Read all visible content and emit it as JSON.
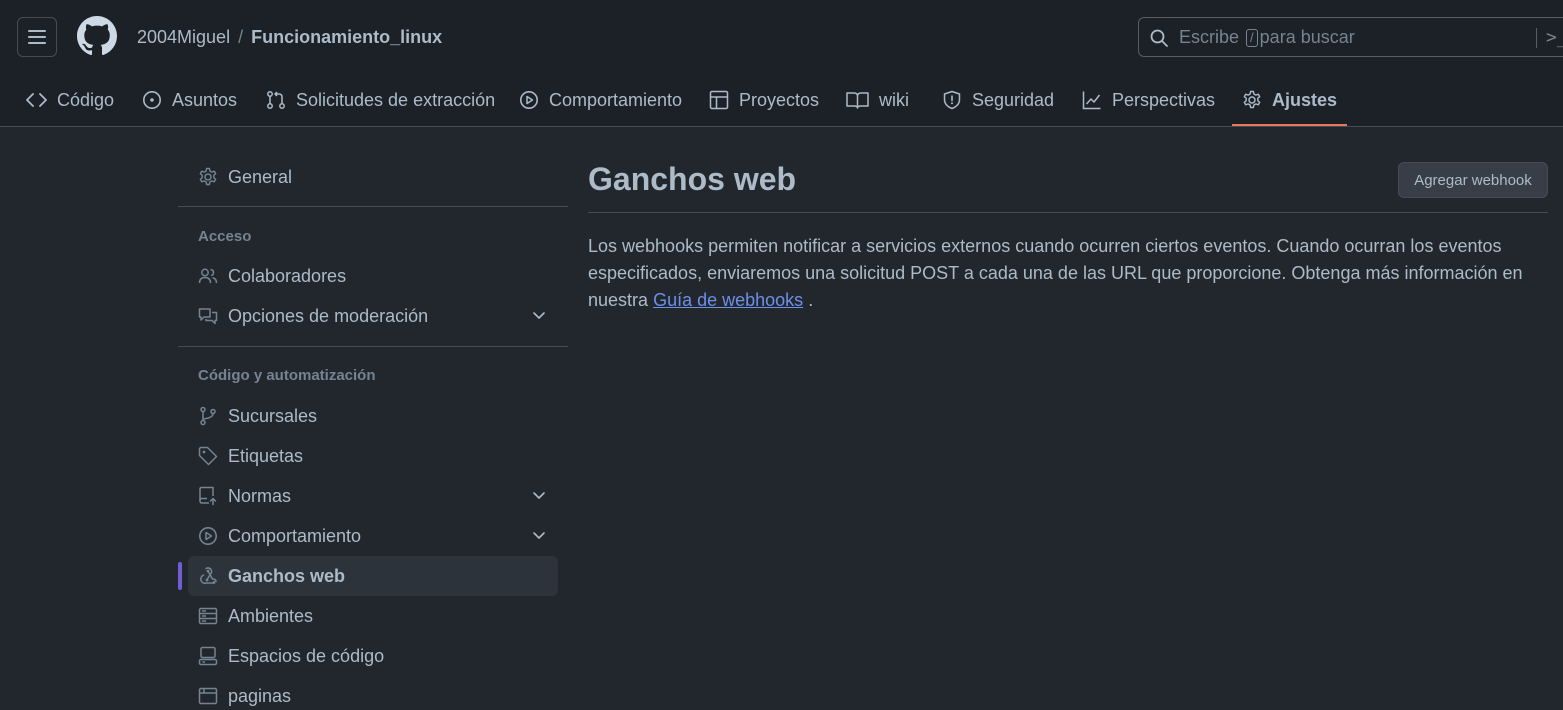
{
  "header": {
    "owner": "2004Miguel",
    "separator": "/",
    "repo": "Funcionamiento_linux",
    "search": {
      "prefix": "Escribe",
      "key": "/",
      "suffix": "para buscar",
      "command": ">_"
    }
  },
  "tabs": [
    {
      "label": "Código",
      "icon": "code-icon"
    },
    {
      "label": "Asuntos",
      "icon": "issue-opened-icon"
    },
    {
      "label": "Solicitudes de extracción",
      "icon": "git-pull-request-icon"
    },
    {
      "label": "Comportamiento",
      "icon": "play-icon"
    },
    {
      "label": "Proyectos",
      "icon": "table-icon"
    },
    {
      "label": "wiki",
      "icon": "book-icon"
    },
    {
      "label": "Seguridad",
      "icon": "shield-icon"
    },
    {
      "label": "Perspectivas",
      "icon": "graph-icon"
    },
    {
      "label": "Ajustes",
      "icon": "gear-icon",
      "active": true
    }
  ],
  "sidebar": {
    "general": "General",
    "access_heading": "Acceso",
    "access": [
      {
        "label": "Colaboradores",
        "icon": "people-icon"
      },
      {
        "label": "Opciones de moderación",
        "icon": "comment-discussion-icon",
        "expandable": true
      }
    ],
    "code_heading": "Código y automatización",
    "code": [
      {
        "label": "Sucursales",
        "icon": "git-branch-icon"
      },
      {
        "label": "Etiquetas",
        "icon": "tag-icon"
      },
      {
        "label": "Normas",
        "icon": "repo-push-icon",
        "expandable": true
      },
      {
        "label": "Comportamiento",
        "icon": "play-icon",
        "expandable": true
      },
      {
        "label": "Ganchos web",
        "icon": "webhook-icon",
        "active": true
      },
      {
        "label": "Ambientes",
        "icon": "server-icon"
      },
      {
        "label": "Espacios de código",
        "icon": "codespaces-icon"
      },
      {
        "label": "paginas",
        "icon": "browser-icon"
      }
    ]
  },
  "main": {
    "title": "Ganchos web",
    "add_button": "Agregar webhook",
    "description_before": "Los webhooks permiten notificar a servicios externos cuando ocurren ciertos eventos. Cuando ocurran los eventos especificados, enviaremos una solicitud POST a cada una de las URL que proporcione. Obtenga más información en nuestra",
    "description_link": "Guía de webhooks",
    "description_after": "."
  },
  "colors": {
    "background": "#22272e",
    "header": "#1c2128",
    "active_tab_underline": "#ec775c",
    "active_sidebar_marker": "#6e5fd3",
    "link": "#6e8fe8"
  }
}
